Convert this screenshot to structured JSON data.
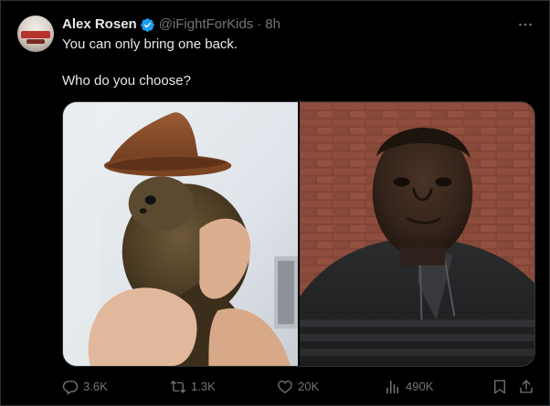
{
  "tweet": {
    "author": {
      "display_name": "Alex Rosen",
      "handle": "@iFightForKids",
      "verified_icon": "verified-badge-icon",
      "time_separator": "·",
      "time": "8h"
    },
    "text_lines": [
      "You can only bring one back.",
      "Who do you choose?"
    ],
    "media": [
      {
        "description_icon": "squirrel-cowboy-hat-image"
      },
      {
        "description_icon": "man-portrait-image"
      }
    ],
    "actions": {
      "reply_count": "3.6K",
      "retweet_count": "1.3K",
      "like_count": "20K",
      "views_count": "490K"
    }
  },
  "colors": {
    "background": "#000000",
    "text_primary": "#e7e9ea",
    "text_secondary": "#71767b",
    "verified": "#1d9bf0",
    "border": "#2f3336"
  }
}
